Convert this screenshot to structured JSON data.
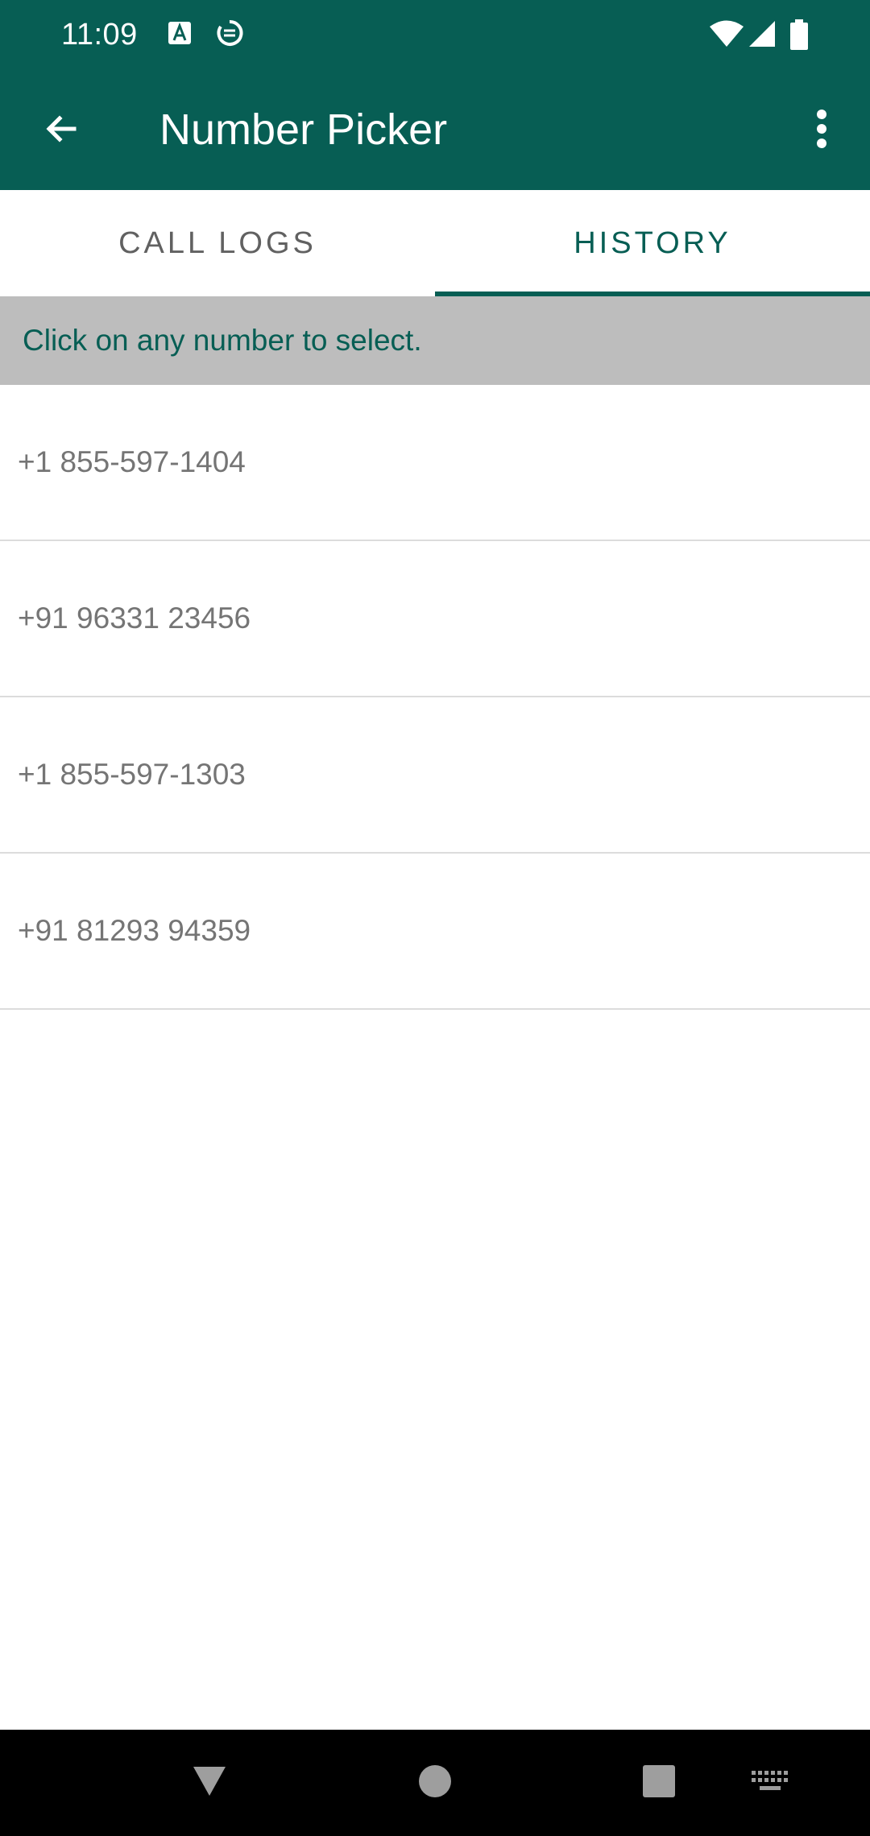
{
  "status_bar": {
    "time": "11:09",
    "icons": [
      "translate-icon",
      "data-saver-icon",
      "wifi-icon",
      "cellular-signal-icon",
      "battery-icon"
    ]
  },
  "app_bar": {
    "title": "Number Picker",
    "back_icon": "arrow-back-icon",
    "menu_icon": "more-vert-icon"
  },
  "tabs": [
    {
      "label": "CALL LOGS",
      "active": false
    },
    {
      "label": "HISTORY",
      "active": true
    }
  ],
  "hint": "Click on any number to select.",
  "numbers": [
    "+1 855-597-1404",
    "+91 96331 23456",
    "+1 855-597-1303",
    "+91 81293 94359"
  ],
  "nav_bar": {
    "buttons": [
      "back-triangle-icon",
      "home-circle-icon",
      "recents-square-icon",
      "keyboard-icon"
    ]
  },
  "colors": {
    "primary": "#075e54",
    "hint_background": "#bdbdbd",
    "list_text": "#757575",
    "tab_inactive": "#616161"
  }
}
